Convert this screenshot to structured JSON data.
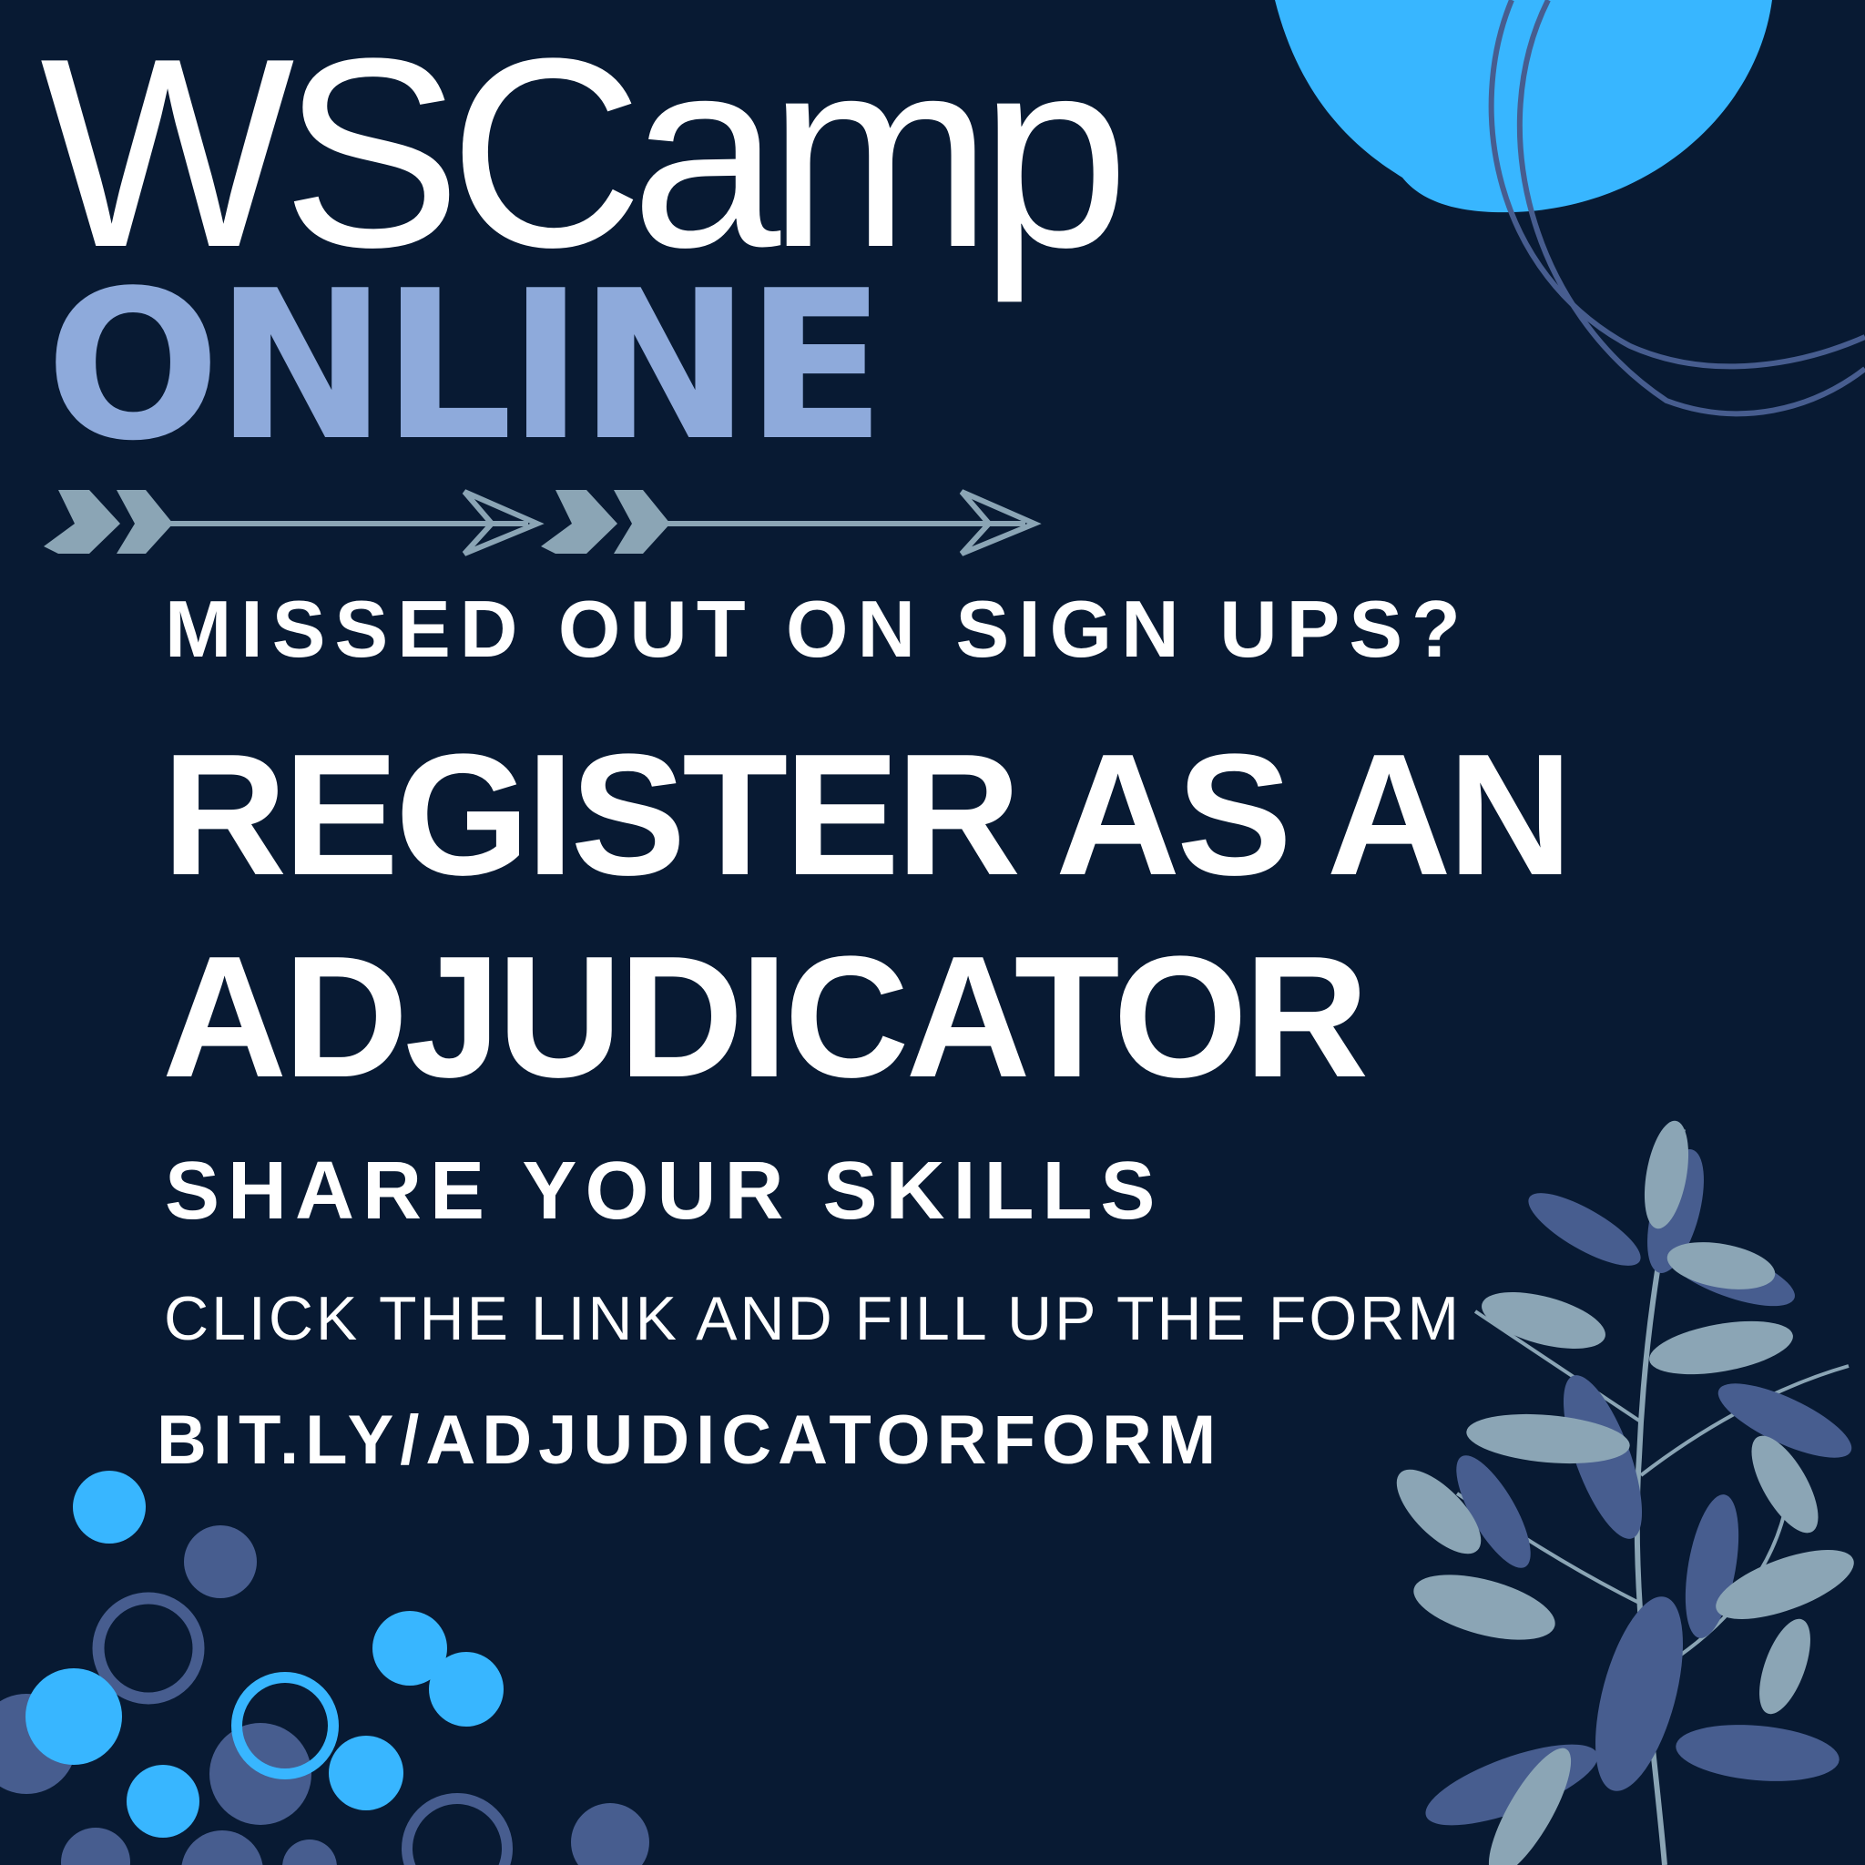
{
  "brand": {
    "title": "WSCamp",
    "subtitle": "ONLINE"
  },
  "headline": {
    "question": "MISSED OUT ON SIGN UPS?",
    "line1": "REGISTER AS AN",
    "line2": "ADJUDICATOR",
    "tagline": "SHARE YOUR SKILLS",
    "instruction": "CLICK THE LINK AND FILL UP THE FORM",
    "link": "BIT.LY/ADJUDICATORFORM"
  },
  "colors": {
    "background": "#081a33",
    "accent_light_blue": "#38b6ff",
    "accent_muted_blue": "#475d8f",
    "online_text": "#8eaadb",
    "arrow_sage": "#8ba5b5"
  },
  "icons": [
    "arrow-icon",
    "leaf-plant-icon",
    "circle-dots-decoration",
    "blob-decoration"
  ]
}
